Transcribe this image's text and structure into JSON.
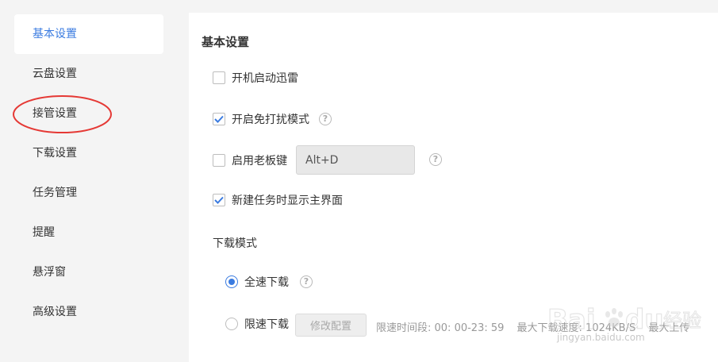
{
  "sidebar": {
    "items": [
      {
        "label": "基本设置",
        "active": true
      },
      {
        "label": "云盘设置"
      },
      {
        "label": "接管设置",
        "circled": true
      },
      {
        "label": "下载设置"
      },
      {
        "label": "任务管理"
      },
      {
        "label": "提醒"
      },
      {
        "label": "悬浮窗"
      },
      {
        "label": "高级设置"
      }
    ]
  },
  "main": {
    "title": "基本设置",
    "options": {
      "auto_start": {
        "label": "开机启动迅雷",
        "checked": false
      },
      "dnd_mode": {
        "label": "开启免打扰模式",
        "checked": true
      },
      "boss_key": {
        "label": "启用老板键",
        "checked": false,
        "hotkey": "Alt+D"
      },
      "show_main_on_new_task": {
        "label": "新建任务时显示主界面",
        "checked": true
      }
    },
    "download_mode": {
      "title": "下载模式",
      "full_speed": {
        "label": "全速下载",
        "selected": true
      },
      "limited": {
        "label": "限速下载",
        "selected": false,
        "modify_button": "修改配置",
        "time_range": "限速时间段:  00: 00-23: 59",
        "max_download": "最大下载速度: 1024KB/S",
        "max_upload": "最大上传"
      }
    }
  },
  "watermark": {
    "text": "jingyan.baidu.com"
  },
  "colors": {
    "accent": "#3a7be0",
    "annotation": "#e53935",
    "sidebar_bg": "#f4f4f4",
    "panel_bg": "#ffffff"
  }
}
